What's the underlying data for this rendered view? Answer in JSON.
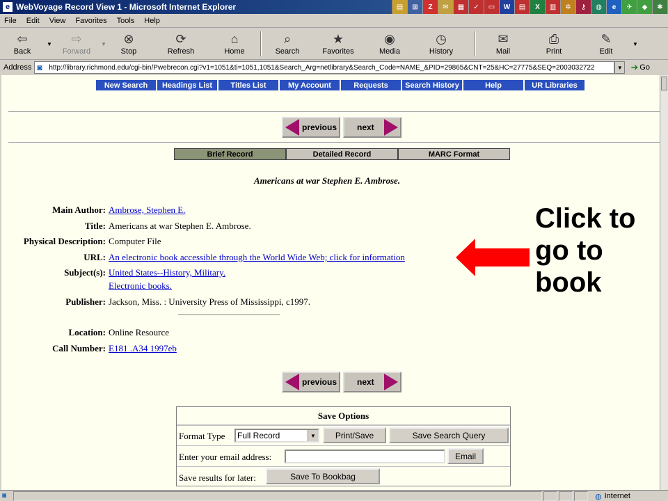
{
  "window": {
    "title": "WebVoyage Record View 1 - Microsoft Internet Explorer",
    "app_icon": "e"
  },
  "quicklaunch": [
    "folder-icon",
    "network-icon",
    "az-icon",
    "mail-icon",
    "note-icon",
    "check-icon",
    "card-icon",
    "word-icon",
    "doc-icon",
    "excel-icon",
    "chart-icon",
    "gear-icon",
    "key-icon",
    "globe-icon",
    "ie-icon",
    "bird-icon",
    "cube-icon",
    "bug-icon"
  ],
  "menu": [
    "File",
    "Edit",
    "View",
    "Favorites",
    "Tools",
    "Help"
  ],
  "toolbar": {
    "back": "Back",
    "forward": "Forward",
    "stop": "Stop",
    "refresh": "Refresh",
    "home": "Home",
    "search": "Search",
    "favorites": "Favorites",
    "media": "Media",
    "history": "History",
    "mail": "Mail",
    "print": "Print",
    "edit": "Edit"
  },
  "address": {
    "label": "Address",
    "url": "http://library.richmond.edu/cgi-bin/Pwebrecon.cgi?v1=1051&ti=1051,1051&Search_Arg=netlibrary&Search_Code=NAME_&PID=29865&CNT=25&HC=27775&SEQ=2003032722",
    "go": "Go"
  },
  "nav_tabs": [
    "New Search",
    "Headings List",
    "Titles List",
    "My Account",
    "Requests",
    "Search History",
    "Help",
    "UR Libraries"
  ],
  "pager": {
    "previous": "previous",
    "next": "next"
  },
  "view_tabs": [
    "Brief Record",
    "Detailed Record",
    "MARC Format"
  ],
  "record": {
    "title": "Americans at war Stephen E. Ambrose.",
    "fields": [
      {
        "label": "Main Author:",
        "value": "Ambrose, Stephen E.",
        "link": true
      },
      {
        "label": "Title:",
        "value": "Americans at war Stephen E. Ambrose.",
        "link": false
      },
      {
        "label": "Physical Description:",
        "value": "Computer File",
        "link": false
      },
      {
        "label": "URL:",
        "value": "An electronic book accessible through the World Wide Web; click for information",
        "link": true
      },
      {
        "label": "Subject(s):",
        "value": "United States--History, Military.",
        "link": true
      },
      {
        "label": "",
        "value": "Electronic books.",
        "link": true
      },
      {
        "label": "Publisher:",
        "value": "Jackson, Miss. : University Press of Mississippi, c1997.",
        "link": false
      },
      {
        "label": "Location:",
        "value": "Online Resource",
        "link": false
      },
      {
        "label": "Call Number:",
        "value": "E181 .A34 1997eb",
        "link": true
      }
    ]
  },
  "save_options": {
    "header": "Save Options",
    "format_label": "Format Type",
    "format_value": "Full Record",
    "print_save": "Print/Save",
    "save_search": "Save Search Query",
    "email_label": "Enter your email address:",
    "email_btn": "Email",
    "bookbag_label": "Save results for later:",
    "bookbag_btn": "Save To Bookbag"
  },
  "annotation": {
    "text": "Click to\ngo to\nbook",
    "arrow_color": "#ff0000"
  },
  "status": {
    "zone": "Internet"
  }
}
